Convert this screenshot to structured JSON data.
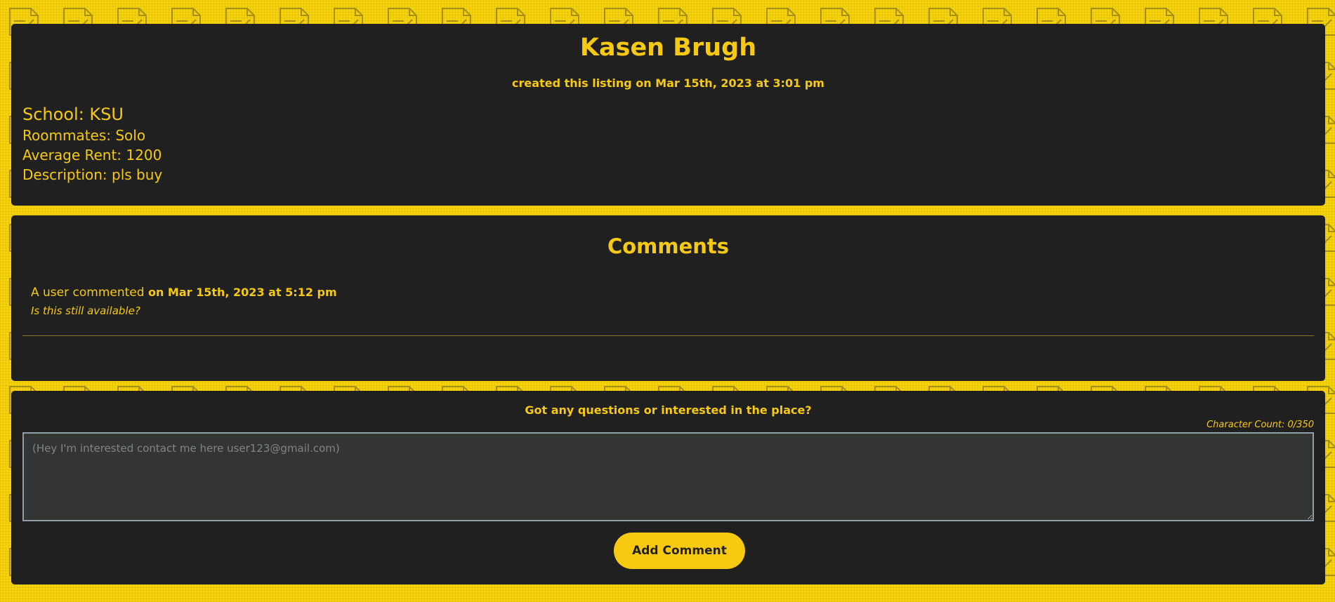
{
  "colors": {
    "page_background": "#f7d308",
    "card_background": "#202020",
    "accent": "#f7c910",
    "textarea_background": "#323532",
    "textarea_border": "#8f9fa9"
  },
  "listing": {
    "name": "Kasen Brugh",
    "created": "created this listing on Mar 15th, 2023 at 3:01 pm",
    "school": "School: KSU",
    "roommates": "Roommates: Solo",
    "rent": "Average Rent: 1200",
    "description": "Description: pls buy"
  },
  "comments": {
    "title": "Comments",
    "items": [
      {
        "author_text": "A user commented",
        "date_text": "on Mar 15th, 2023 at 5:12 pm",
        "body": "Is this still available?"
      }
    ]
  },
  "form": {
    "prompt": "Got any questions or interested in the place?",
    "char_count": "Character Count: 0/350",
    "textarea_placeholder": "(Hey I'm interested contact me here user123@gmail.com)",
    "textarea_value": "",
    "submit_label": "Add Comment"
  },
  "icons": {
    "background": "document-pencil-icon"
  }
}
